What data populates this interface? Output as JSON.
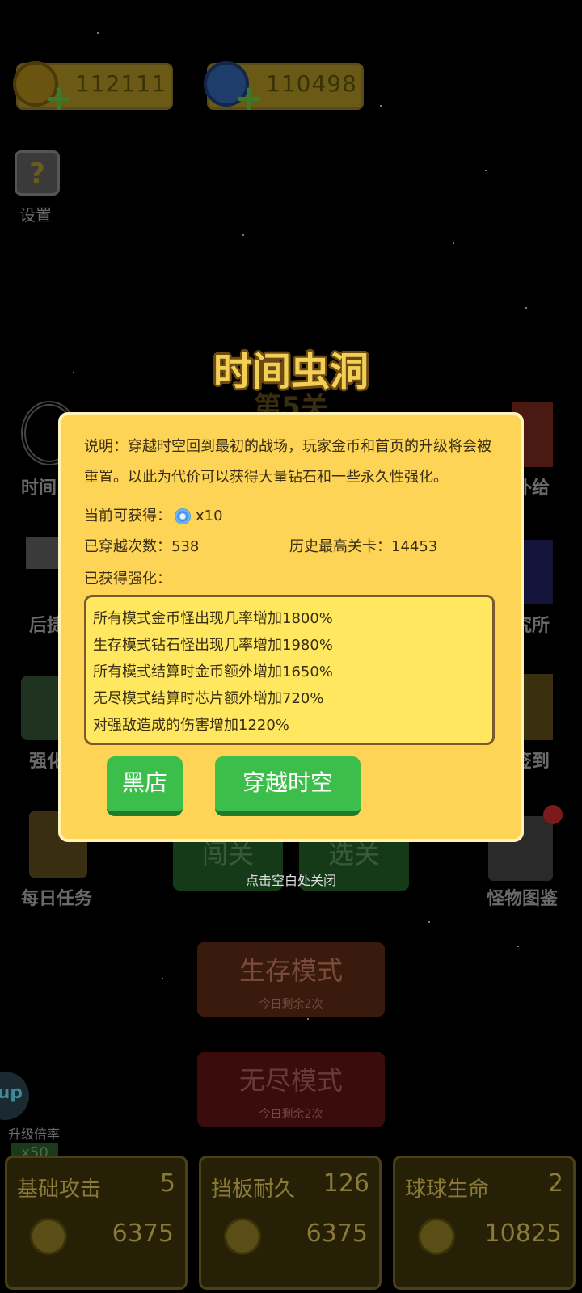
{
  "currencies": {
    "gold": "112111",
    "diamond": "110498"
  },
  "settings_label": "设置",
  "side_left": [
    "时间",
    "后捷",
    "强化",
    "每日任务"
  ],
  "side_right": [
    "补给",
    "究所",
    "签到",
    "怪物图鉴"
  ],
  "behind_stage": "第5关",
  "buttons_dim": {
    "challenge": "闯关",
    "select": "选关"
  },
  "close_hint": "点击空白处关闭",
  "modes": [
    {
      "label": "生存模式",
      "sub": "今日剩余2次"
    },
    {
      "label": "无尽模式",
      "sub": "今日剩余2次"
    }
  ],
  "upgrade_rate": {
    "label": "升级倍率",
    "value": "x50",
    "badge": "up"
  },
  "stats": [
    {
      "name": "基础攻击",
      "level": "5",
      "cost": "6375"
    },
    {
      "name": "挡板耐久",
      "level": "126",
      "cost": "6375"
    },
    {
      "name": "球球生命",
      "level": "2",
      "cost": "10825"
    }
  ],
  "dialog": {
    "title": "时间虫洞",
    "description": "说明：穿越时空回到最初的战场，玩家金币和首页的升级将会被重置。以此为代价可以获得大量钻石和一些永久性强化。",
    "obtain_label": "当前可获得：",
    "obtain_value": "x10",
    "travel_count_label": "已穿越次数：538",
    "highest_level_label": "历史最高关卡：14453",
    "buffs_label": "已获得强化：",
    "buffs": [
      "所有模式金币怪出现几率增加1800%",
      "生存模式钻石怪出现几率增加1980%",
      "所有模式结算时金币额外增加1650%",
      "无尽模式结算时芯片额外增加720%",
      "对强敌造成的伤害增加1220%"
    ],
    "shop_button": "黑店",
    "travel_button": "穿越时空"
  }
}
